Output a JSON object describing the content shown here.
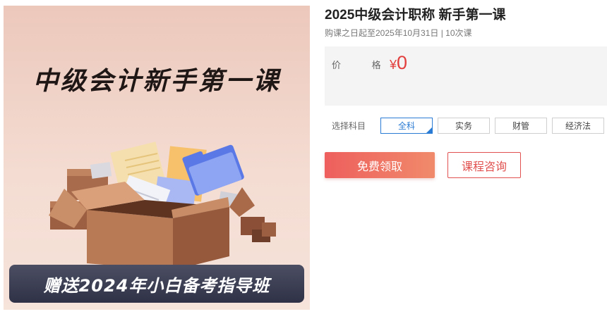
{
  "banner": {
    "title": "中级会计新手第一课",
    "strip_text": "赠送2024年小白备考指导班"
  },
  "course": {
    "title": "2025中级会计职称 新手第一课",
    "meta": "购课之日起至2025年10月31日 | 10次课",
    "price_label": "价 格",
    "currency": "¥",
    "price": "0",
    "price_color": "#e2403f"
  },
  "subjects": {
    "label": "选择科目",
    "options": [
      "全科",
      "实务",
      "财管",
      "经济法"
    ],
    "selected": "全科"
  },
  "actions": {
    "claim_label": "免费领取",
    "consult_label": "课程咨询"
  }
}
